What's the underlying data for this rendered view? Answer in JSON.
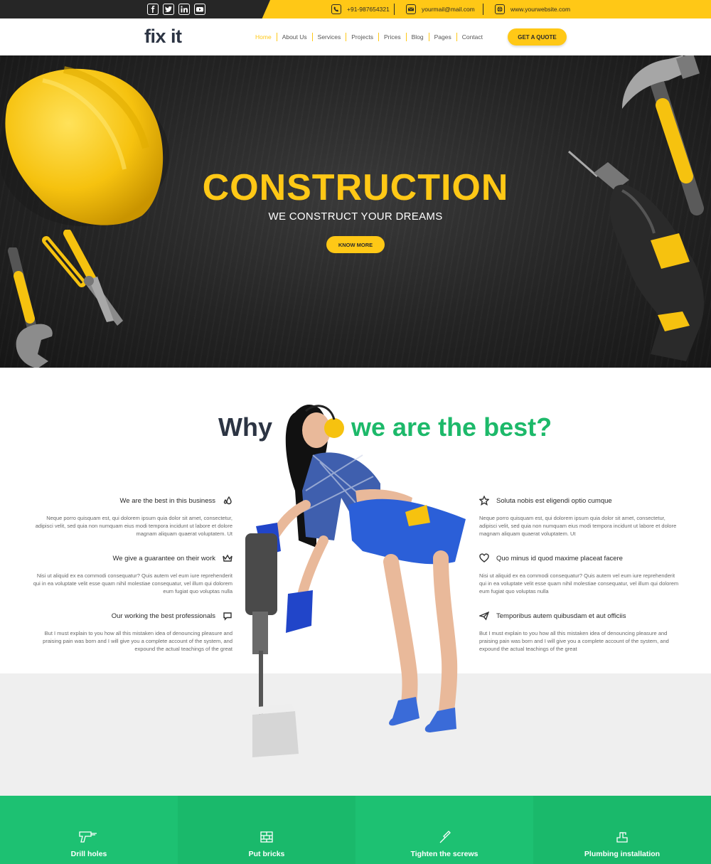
{
  "topbar": {
    "phone": "+91-987654321",
    "email": "yourmail@mail.com",
    "website": "www.yourwebsite.com",
    "social": [
      "facebook-icon",
      "twitter-icon",
      "linkedin-icon",
      "youtube-icon"
    ]
  },
  "brand": {
    "logo_main": "fix ",
    "logo_accent": "it"
  },
  "nav": {
    "items": [
      "Home",
      "About Us",
      "Services",
      "Projects",
      "Prices",
      "Blog",
      "Pages",
      "Contact"
    ],
    "active": "Home",
    "quote_label": "GET A QUOTE"
  },
  "hero": {
    "title": "CONSTRUCTION",
    "subtitle": "WE CONSTRUCT YOUR DREAMS",
    "button": "KNOW MORE"
  },
  "why": {
    "title_left": "Why",
    "title_right": "we are the best?",
    "features_left": [
      {
        "title": "We are the best in this business",
        "icon": "drops-icon",
        "text": "Neque porro quisquam est, qui dolorem ipsum quia dolor sit amet, consectetur, adipisci velit, sed quia non numquam eius modi tempora incidunt ut labore et dolore magnam aliquam quaerat voluptatem. Ut"
      },
      {
        "title": "We give a guarantee on their work",
        "icon": "crown-icon",
        "text": "Nisi ut aliquid ex ea commodi consequatur? Quis autem vel eum iure reprehenderit qui in ea voluptate velit esse quam nihil molestiae consequatur, vel illum qui dolorem eum fugiat quo voluptas nulla"
      },
      {
        "title": "Our working the best professionals",
        "icon": "chat-icon",
        "text": "But I must explain to you how all this mistaken idea of denouncing pleasure and praising pain was born and I will give you a complete account of the system, and expound the actual teachings of the great"
      }
    ],
    "features_right": [
      {
        "title": "Soluta nobis est eligendi optio cumque",
        "icon": "star-icon",
        "text": "Neque porro quisquam est, qui dolorem ipsum quia dolor sit amet, consectetur, adipisci velit, sed quia non numquam eius modi tempora incidunt ut labore et dolore magnam aliquam quaerat voluptatem. Ut"
      },
      {
        "title": "Quo minus id quod maxime placeat facere",
        "icon": "heart-icon",
        "text": "Nisi ut aliquid ex ea commodi consequatur? Quis autem vel eum iure reprehenderit qui in ea voluptate velit esse quam nihil molestiae consequatur, vel illum qui dolorem eum fugiat quo voluptas nulla"
      },
      {
        "title": "Temporibus autem quibusdam et aut officiis",
        "icon": "paper-plane-icon",
        "text": "But I must explain to you how all this mistaken idea of denouncing pleasure and praising pain was born and I will give you a complete account of the system, and expound the actual teachings of the great"
      }
    ]
  },
  "services": [
    {
      "label": "Drill holes",
      "icon": "drill-icon"
    },
    {
      "label": "Put bricks",
      "icon": "bricks-icon"
    },
    {
      "label": "Tighten the screws",
      "icon": "screwdriver-icon"
    },
    {
      "label": "Plumbing installation",
      "icon": "faucet-icon"
    }
  ],
  "colors": {
    "accent": "#ffc816",
    "green": "#1db96a",
    "dark": "#2c3443"
  }
}
